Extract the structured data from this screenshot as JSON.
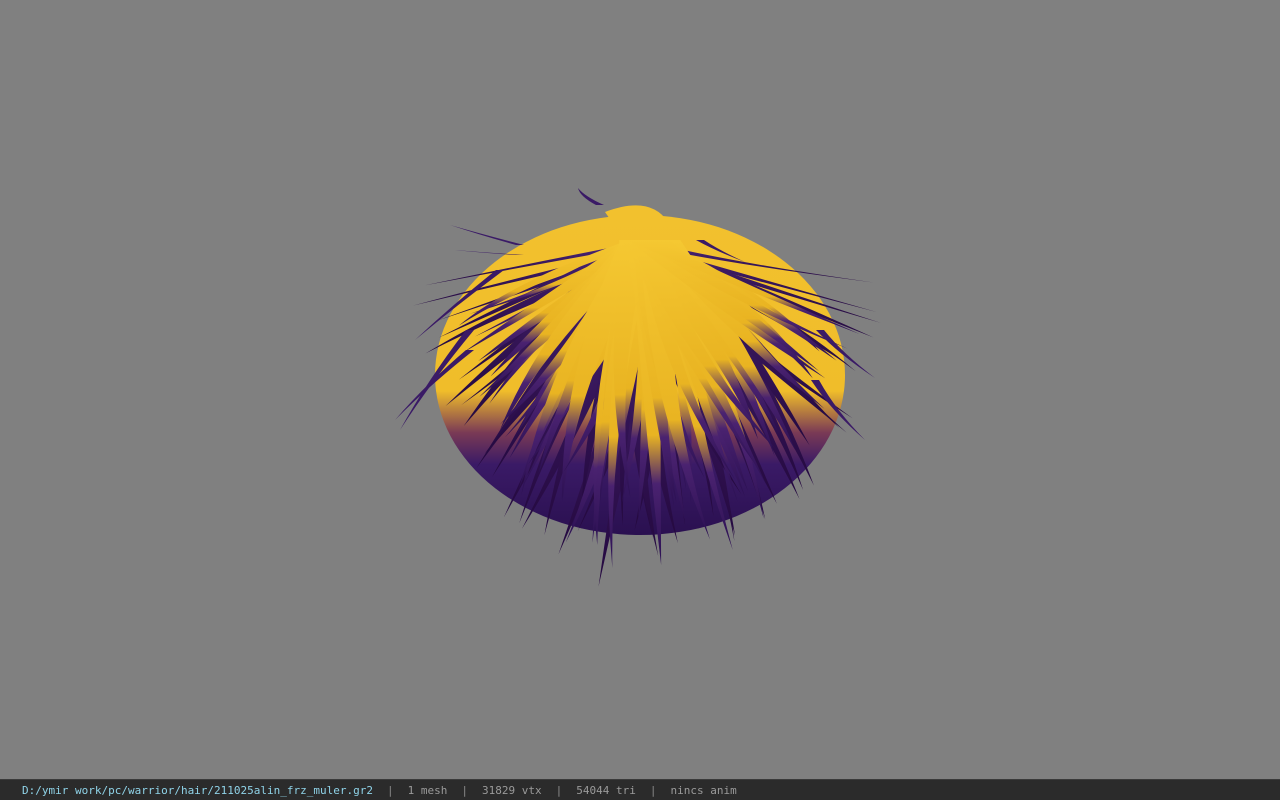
{
  "viewport": {
    "background": "#808080",
    "model": {
      "kind": "hair-mesh",
      "top_color": "#f2c12e",
      "tip_color": "#3a1a66"
    }
  },
  "statusbar": {
    "file_path": "D:/ymir work/pc/warrior/hair/211025alin_frz_muler.gr2",
    "separator": "|",
    "mesh_count": "1 mesh",
    "vertex_count": "31829 vtx",
    "triangle_count": "54044 tri",
    "anim_status": "nincs anim"
  }
}
